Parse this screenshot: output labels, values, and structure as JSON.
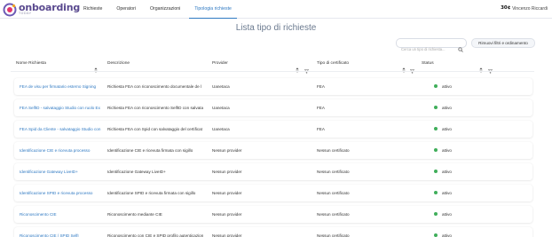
{
  "app": {
    "logo_main": "onboarding",
    "logo_sub": "TODAY"
  },
  "nav": {
    "tabs": [
      {
        "label": "Richieste",
        "active": false
      },
      {
        "label": "Operatori",
        "active": false
      },
      {
        "label": "Organizzazioni",
        "active": false
      },
      {
        "label": "Tipologia richieste",
        "active": true
      }
    ]
  },
  "user": {
    "initials": "30¢",
    "name": "Vincenzo Riccardi"
  },
  "page": {
    "title": "Lista tipo di richieste"
  },
  "toolbar": {
    "search_placeholder": "Cerca un tipo di richiesta...",
    "reset_label": "Rimuovi filtri e ordinamento"
  },
  "table": {
    "columns": [
      {
        "label": "Nome Richiesta",
        "sortable": true,
        "filterable": false
      },
      {
        "label": "Descrizione",
        "sortable": false,
        "filterable": false
      },
      {
        "label": "Provider",
        "sortable": true,
        "filterable": true
      },
      {
        "label": "Tipo di certificato",
        "sortable": true,
        "filterable": true
      },
      {
        "label": "Status",
        "sortable": true,
        "filterable": true
      }
    ],
    "rows": [
      {
        "name": "FEA de visu per firmatario esterno Signing",
        "description": "Richiesta FEA con riconoscimento documentale de l",
        "provider": "Uanetaca",
        "certificate": "FEA",
        "status": "attivo"
      },
      {
        "name": "FEA SelfID - salvataggio Studio con ruolo Ex",
        "description": "Richiesta FEA con riconoscimento SelfID con salvata",
        "provider": "Uanetaca",
        "certificate": "FEA",
        "status": "attivo"
      },
      {
        "name": "FEA Spid da Cliente - salvataggio Studio con",
        "description": "Richiesta FEA con Spid con salvataggio del certificat",
        "provider": "Uanetaca",
        "certificate": "FEA",
        "status": "attivo"
      },
      {
        "name": "Identificazione CIE e ricevuta processo",
        "description": "Identificazione CIE e ricevuta firmata con sigillo",
        "provider": "Nessun provider",
        "certificate": "Nessun certificato",
        "status": "attivo"
      },
      {
        "name": "Identificazione Gateway LiveID+",
        "description": "Identificazione Gateway LiveID+",
        "provider": "Nessun provider",
        "certificate": "Nessun certificato",
        "status": "attivo"
      },
      {
        "name": "Identificazione SPID e ricevuta processo",
        "description": "Identificazione SPID e ricevuta firmata con sigillo",
        "provider": "Nessun provider",
        "certificate": "Nessun certificato",
        "status": "attivo"
      },
      {
        "name": "Riconoscimento CIE",
        "description": "Riconoscimento mediante CIE",
        "provider": "Nessun provider",
        "certificate": "Nessun certificato",
        "status": "attivo"
      },
      {
        "name": "Riconoscimento CIE / SPID SelfI",
        "description": "Riconoscimento con CIE e SPID profilo autenticazion",
        "provider": "Nessun provider",
        "certificate": "Nessun certificato",
        "status": "attivo"
      }
    ]
  },
  "colors": {
    "accent": "#2f79c2",
    "status_active": "#3fae5a",
    "logo": "#5a4a8f"
  }
}
